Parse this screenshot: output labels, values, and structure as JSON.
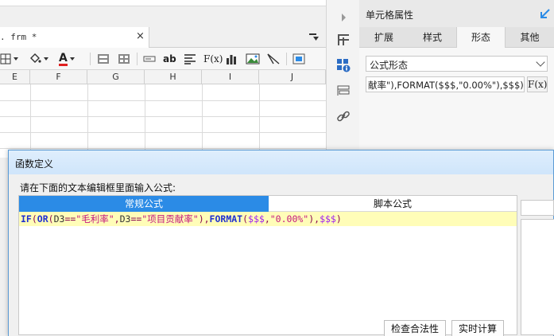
{
  "file_tab": {
    "name": ". frm *",
    "close": "×"
  },
  "sheet": {
    "columns": [
      "E",
      "F",
      "G",
      "H",
      "I",
      "J"
    ]
  },
  "toolbar": {
    "text_sample": "A",
    "ab_label": "ab",
    "fx_label": "F(x)"
  },
  "property_panel": {
    "title": "单元格属性",
    "tabs": [
      {
        "label": "扩展"
      },
      {
        "label": "样式"
      },
      {
        "label": "形态",
        "active": true
      },
      {
        "label": "其他"
      }
    ],
    "form_select": {
      "value": "公式形态"
    },
    "formula_field": {
      "value": "献率\"),FORMAT($$$,\"0.00%\"),$$$)"
    },
    "fx_button": "F(x)"
  },
  "dialog": {
    "title": "函数定义",
    "instruction": "请在下面的文本编辑框里面输入公式:",
    "tabs": [
      {
        "label": "常规公式",
        "active": true
      },
      {
        "label": "脚本公式",
        "active": false
      }
    ],
    "formula": "IF(OR(D3==\"毛利率\",D3==\"项目贡献率\"),FORMAT($$$,\"0.00%\"),$$$)",
    "formula_tokens": [
      {
        "t": "IF",
        "c": "kw"
      },
      {
        "t": "(",
        "c": "pn"
      },
      {
        "t": "OR",
        "c": "kw"
      },
      {
        "t": "(",
        "c": "pn"
      },
      {
        "t": "D3",
        "c": "ident"
      },
      {
        "t": "==",
        "c": "pn"
      },
      {
        "t": "\"毛利率\"",
        "c": "str"
      },
      {
        "t": ",",
        "c": "pn"
      },
      {
        "t": "D3",
        "c": "ident"
      },
      {
        "t": "==",
        "c": "pn"
      },
      {
        "t": "\"项目贡献率\"",
        "c": "str"
      },
      {
        "t": "),",
        "c": "pn"
      },
      {
        "t": "FORMAT",
        "c": "kw"
      },
      {
        "t": "(",
        "c": "pn"
      },
      {
        "t": "$$$",
        "c": "varv"
      },
      {
        "t": ",",
        "c": "pn"
      },
      {
        "t": "\"0.00%\"",
        "c": "str"
      },
      {
        "t": "),",
        "c": "pn"
      },
      {
        "t": "$$$",
        "c": "varv"
      },
      {
        "t": ")",
        "c": "pn"
      }
    ],
    "buttons": {
      "check": "检查合法性",
      "realtime": "实时计算"
    }
  },
  "colors": {
    "accent": "#2b8be6",
    "editor_bg": "#fffdb8",
    "keyword": "#1e2fd0",
    "string": "#c4177e"
  }
}
